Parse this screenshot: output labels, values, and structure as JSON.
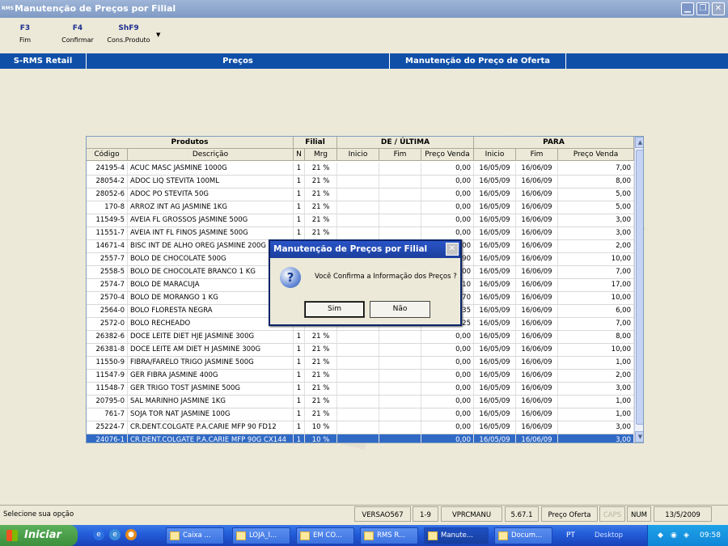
{
  "window": {
    "title": "Manutenção de Preços por Filial",
    "app_icon_text": "RMS"
  },
  "toolbar": {
    "items": [
      {
        "key": "F3",
        "label": "Fim"
      },
      {
        "key": "F4",
        "label": "Confirmar"
      },
      {
        "key": "ShF9",
        "label": "Cons.Produto"
      }
    ]
  },
  "header": {
    "app": "S-RMS Retail",
    "module": "Preços",
    "screen": "Manutenção do Preço de Oferta"
  },
  "grid": {
    "groups": {
      "produtos": "Produtos",
      "filial": "Filial",
      "de": "DE / ÚLTIMA",
      "para": "PARA"
    },
    "columns": {
      "codigo": "Código",
      "descricao": "Descrição",
      "n": "N",
      "mrg": "Mrg",
      "inicio": "Inicio",
      "fim": "Fim",
      "preco": "Preço Venda",
      "p_inicio": "Inicio",
      "p_fim": "Fim",
      "p_preco": "Preço Venda"
    },
    "rows": [
      {
        "codigo": "24195-4",
        "descricao": "ACUC MASC JASMINE 1000G",
        "n": "1",
        "mrg": "21 %",
        "de_preco": "0,00",
        "inicio": "16/05/09",
        "fim": "16/06/09",
        "preco": "7,00"
      },
      {
        "codigo": "28054-2",
        "descricao": "ADOC LIQ STEVITA 100ML",
        "n": "1",
        "mrg": "21 %",
        "de_preco": "0,00",
        "inicio": "16/05/09",
        "fim": "16/06/09",
        "preco": "8,00"
      },
      {
        "codigo": "28052-6",
        "descricao": "ADOC PO STEVITA 50G",
        "n": "1",
        "mrg": "21 %",
        "de_preco": "0,00",
        "inicio": "16/05/09",
        "fim": "16/06/09",
        "preco": "5,00"
      },
      {
        "codigo": "170-8",
        "descricao": "ARROZ INT AG JASMINE 1KG",
        "n": "1",
        "mrg": "21 %",
        "de_preco": "0,00",
        "inicio": "16/05/09",
        "fim": "16/06/09",
        "preco": "5,00"
      },
      {
        "codigo": "11549-5",
        "descricao": "AVEIA FL GROSSOS JASMINE 500G",
        "n": "1",
        "mrg": "21 %",
        "de_preco": "0,00",
        "inicio": "16/05/09",
        "fim": "16/06/09",
        "preco": "3,00"
      },
      {
        "codigo": "11551-7",
        "descricao": "AVEIA INT FL FINOS JASMINE 500G",
        "n": "1",
        "mrg": "21 %",
        "de_preco": "0,00",
        "inicio": "16/05/09",
        "fim": "16/06/09",
        "preco": "3,00"
      },
      {
        "codigo": "14671-4",
        "descricao": "BISC INT DE ALHO OREG JASMINE 200G",
        "n": "",
        "mrg": "",
        "de_preco": "0,00",
        "inicio": "16/05/09",
        "fim": "16/06/09",
        "preco": "2,00"
      },
      {
        "codigo": "2557-7",
        "descricao": "BOLO DE CHOCOLATE 500G",
        "n": "",
        "mrg": "",
        "de_preco": "90",
        "inicio": "16/05/09",
        "fim": "16/06/09",
        "preco": "10,00"
      },
      {
        "codigo": "2558-5",
        "descricao": "BOLO DE CHOCOLATE BRANCO 1 KG",
        "n": "",
        "mrg": "",
        "de_preco": "00",
        "inicio": "16/05/09",
        "fim": "16/06/09",
        "preco": "7,00"
      },
      {
        "codigo": "2574-7",
        "descricao": "BOLO DE MARACUJA",
        "n": "",
        "mrg": "",
        "de_preco": "10",
        "inicio": "16/05/09",
        "fim": "16/06/09",
        "preco": "17,00"
      },
      {
        "codigo": "2570-4",
        "descricao": "BOLO DE MORANGO 1 KG",
        "n": "",
        "mrg": "",
        "de_preco": "70",
        "inicio": "16/05/09",
        "fim": "16/06/09",
        "preco": "10,00"
      },
      {
        "codigo": "2564-0",
        "descricao": "BOLO FLORESTA NEGRA",
        "n": "",
        "mrg": "",
        "de_preco": "35",
        "inicio": "16/05/09",
        "fim": "16/06/09",
        "preco": "6,00"
      },
      {
        "codigo": "2572-0",
        "descricao": "BOLO RECHEADO",
        "n": "",
        "mrg": "",
        "de_preco": "25",
        "inicio": "16/05/09",
        "fim": "16/06/09",
        "preco": "7,00"
      },
      {
        "codigo": "26382-6",
        "descricao": "DOCE  LEITE DIET HJE JASMINE 300G",
        "n": "1",
        "mrg": "21 %",
        "de_preco": "0,00",
        "inicio": "16/05/09",
        "fim": "16/06/09",
        "preco": "8,00"
      },
      {
        "codigo": "26381-8",
        "descricao": "DOCE LEITE AM DIET H JASMINE 300G",
        "n": "1",
        "mrg": "21 %",
        "de_preco": "0,00",
        "inicio": "16/05/09",
        "fim": "16/06/09",
        "preco": "10,00"
      },
      {
        "codigo": "11550-9",
        "descricao": "FIBRA/FARELO TRIGO JASMINE 500G",
        "n": "1",
        "mrg": "21 %",
        "de_preco": "0,00",
        "inicio": "16/05/09",
        "fim": "16/06/09",
        "preco": "1,00"
      },
      {
        "codigo": "11547-9",
        "descricao": "GER FIBRA JASMINE 400G",
        "n": "1",
        "mrg": "21 %",
        "de_preco": "0,00",
        "inicio": "16/05/09",
        "fim": "16/06/09",
        "preco": "2,00"
      },
      {
        "codigo": "11548-7",
        "descricao": "GER TRIGO TOST JASMINE 500G",
        "n": "1",
        "mrg": "21 %",
        "de_preco": "0,00",
        "inicio": "16/05/09",
        "fim": "16/06/09",
        "preco": "3,00"
      },
      {
        "codigo": "20795-0",
        "descricao": "SAL MARINHO JASMINE 1KG",
        "n": "1",
        "mrg": "21 %",
        "de_preco": "0,00",
        "inicio": "16/05/09",
        "fim": "16/06/09",
        "preco": "1,00"
      },
      {
        "codigo": "761-7",
        "descricao": "SOJA TOR NAT JASMINE 100G",
        "n": "1",
        "mrg": "21 %",
        "de_preco": "0,00",
        "inicio": "16/05/09",
        "fim": "16/06/09",
        "preco": "1,00"
      },
      {
        "codigo": "25224-7",
        "descricao": "CR.DENT.COLGATE P.A.CARIE MFP 90 FD12",
        "n": "1",
        "mrg": "10 %",
        "de_preco": "0,00",
        "inicio": "16/05/09",
        "fim": "16/06/09",
        "preco": "3,00"
      },
      {
        "codigo": "24076-1",
        "descricao": "CR.DENT.COLGATE P.A.CARIE MFP 90G CX144",
        "n": "1",
        "mrg": "10 %",
        "de_preco": "0,00",
        "inicio": "16/05/09",
        "fim": "16/06/09",
        "preco": "3,00"
      }
    ],
    "selected_row": 21
  },
  "dialog": {
    "title": "Manutenção de Preços por Filial",
    "icon": "?",
    "message": "Você Confirma a Informação dos Preços ?",
    "yes": "Sim",
    "no": "Não"
  },
  "statusbar": {
    "message": "Selecione sua opção",
    "panels": [
      "VERSAO567",
      "1-9",
      "VPRCMANU",
      "5.67.1",
      "Preço Oferta",
      "CAPS",
      "NUM",
      "13/5/2009"
    ]
  },
  "taskbar": {
    "start": "Iniciar",
    "tasks": [
      "Caixa ...",
      "LOJA_I...",
      "EM CO...",
      "RMS R...",
      "Manute...",
      "Docum..."
    ],
    "lang": "PT",
    "desktop": "Desktop",
    "clock": "09:58"
  }
}
